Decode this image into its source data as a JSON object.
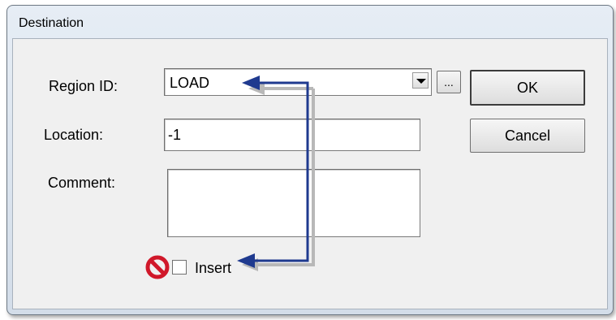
{
  "window": {
    "title": "Destination"
  },
  "form": {
    "region_id_label": "Region ID:",
    "region_id_value": "LOAD",
    "browse_label": "...",
    "location_label": "Location:",
    "location_value": "-1",
    "comment_label": "Comment:",
    "comment_value": "",
    "insert_label": "Insert",
    "insert_checked": false
  },
  "buttons": {
    "ok_label": "OK",
    "cancel_label": "Cancel"
  },
  "annotation": {
    "arrow_color": "#1f3a8f",
    "prohibited_icon": "no-entry-icon",
    "prohibited_color": "#d0182a"
  }
}
